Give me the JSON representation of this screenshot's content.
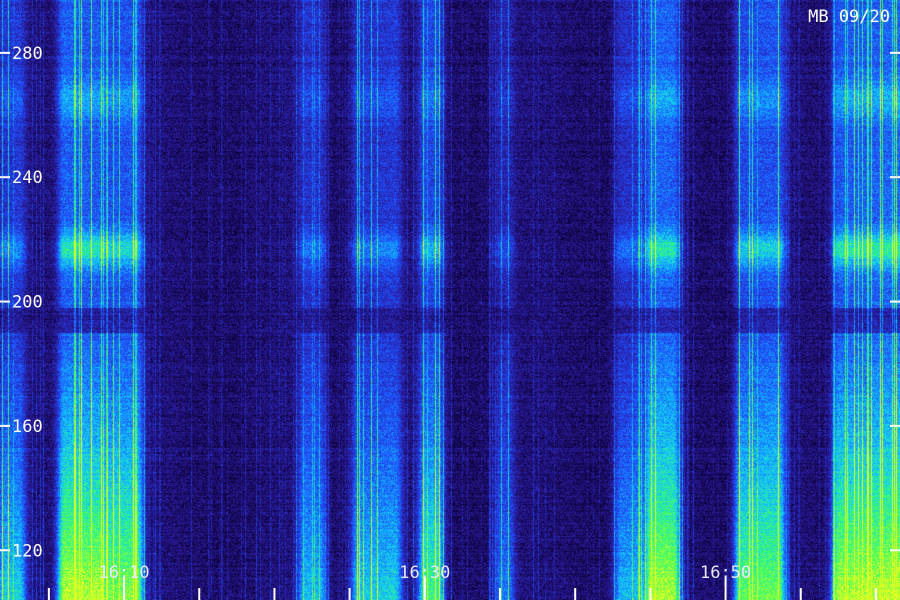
{
  "chart_data": {
    "type": "heatmap",
    "title": "MB 09/20",
    "y_ticks": [
      120,
      160,
      200,
      240,
      280
    ],
    "ylim": [
      104,
      297
    ],
    "x_ticks": [
      "16:10",
      "16:30",
      "16:50"
    ],
    "x_tick_values_min": [
      10,
      30,
      50
    ],
    "xlim_min": [
      1.75,
      61.6
    ],
    "x_minor_tick_step_min": 5,
    "colors": [
      "#0a0030",
      "#2a1a9a",
      "#1e50ff",
      "#10c8ff",
      "#40ff60",
      "#e0ff20"
    ],
    "activity_bands_min": [
      {
        "start": 2,
        "end": 3,
        "level": 0.6
      },
      {
        "start": 6,
        "end": 8.5,
        "level": 1.0
      },
      {
        "start": 9,
        "end": 10.8,
        "level": 0.9
      },
      {
        "start": 22,
        "end": 23,
        "level": 0.55
      },
      {
        "start": 25.5,
        "end": 28,
        "level": 0.6
      },
      {
        "start": 30,
        "end": 30.8,
        "level": 0.75
      },
      {
        "start": 35,
        "end": 35.5,
        "level": 0.4
      },
      {
        "start": 43,
        "end": 44.5,
        "level": 0.55
      },
      {
        "start": 45,
        "end": 46.5,
        "level": 0.95
      },
      {
        "start": 51,
        "end": 53.5,
        "level": 0.85
      },
      {
        "start": 57.5,
        "end": 61.6,
        "level": 1.0
      }
    ]
  }
}
